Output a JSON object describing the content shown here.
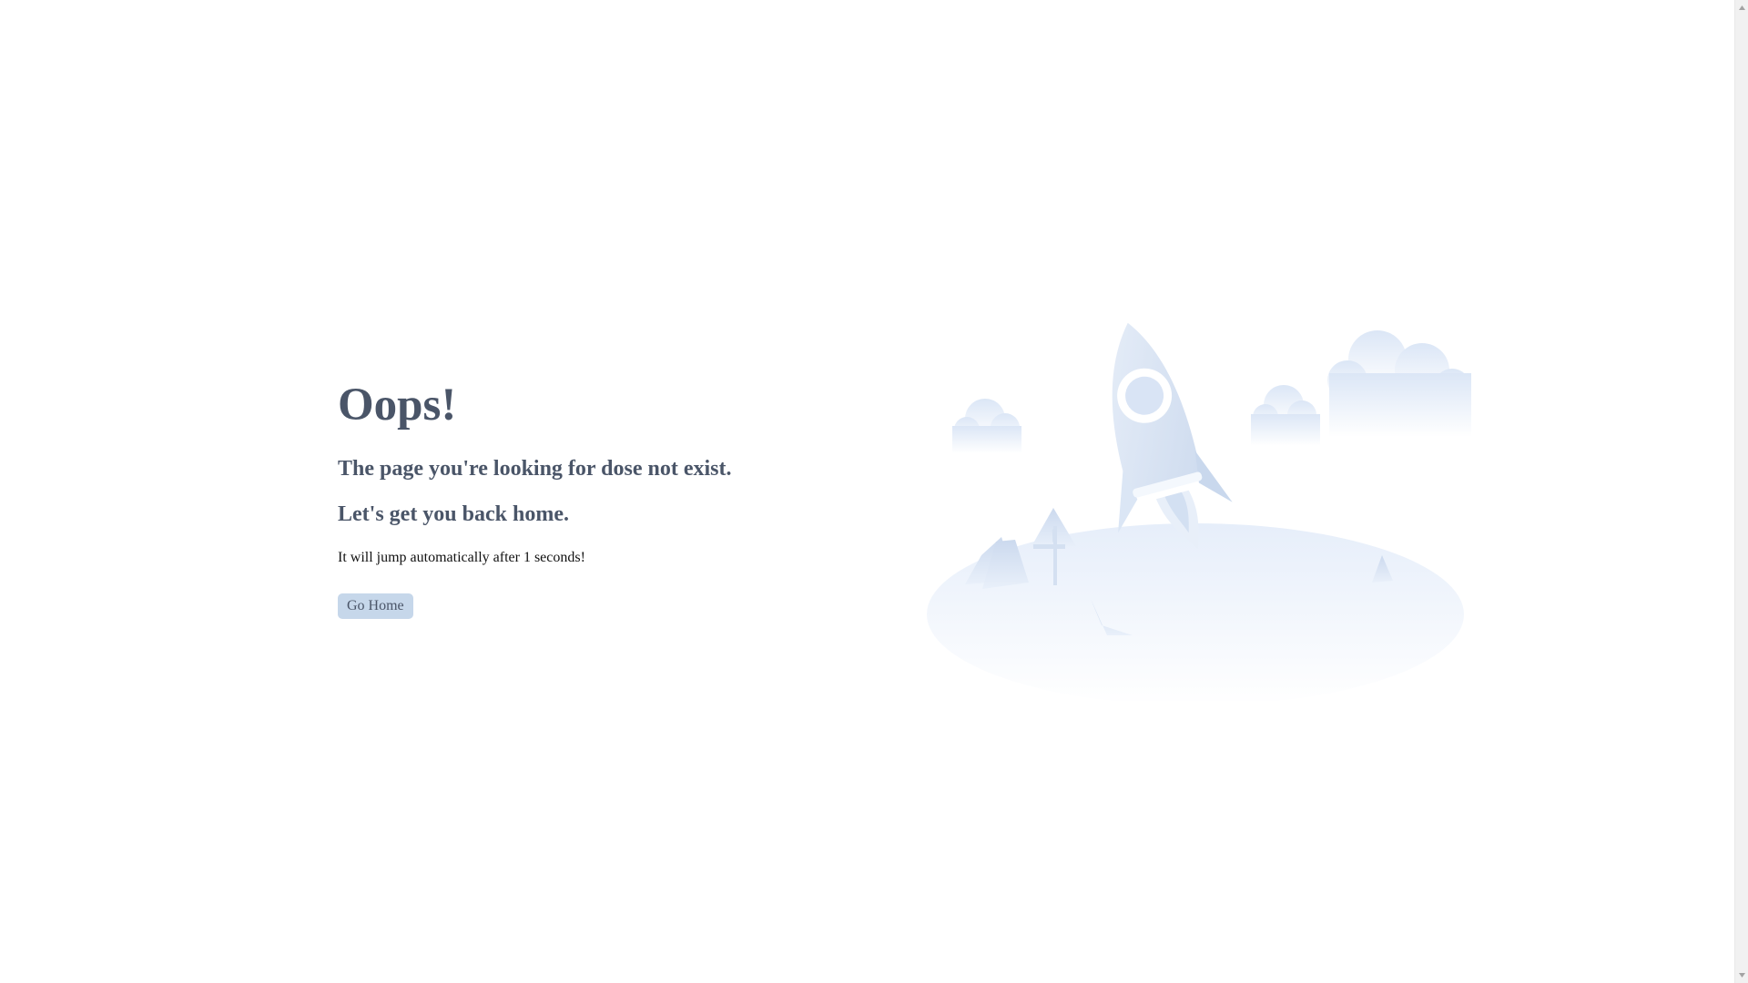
{
  "error": {
    "title": "Oops!",
    "subtitle": "The page you're looking for dose not exist.",
    "subtitle2": "Let's get you back home.",
    "info": "It will jump automatically after 1 seconds!",
    "button_label": "Go Home"
  },
  "colors": {
    "heading": "#4a5568",
    "button_bg": "#c6d7ea",
    "illustration": "#dce8f7"
  },
  "icons": {
    "illustration": "rocket-illustration-icon"
  }
}
